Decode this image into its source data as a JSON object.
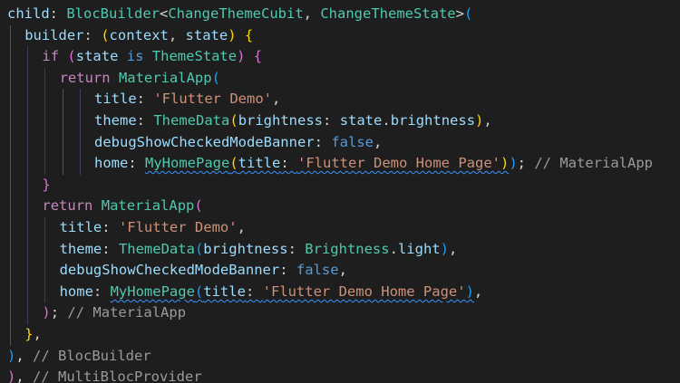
{
  "editor": {
    "theme": {
      "background": "#1e1e1e",
      "default": "#d4d4d4",
      "property": "#9cdcfe",
      "type": "#4ec9b0",
      "keyword_control": "#c586c0",
      "keyword": "#569cd6",
      "string": "#ce9178",
      "comment": "#6a9955",
      "bracket_1": "#ffd700",
      "bracket_2": "#da70d6",
      "bracket_3": "#179fff",
      "warning_squiggle": "#3794ff"
    },
    "lines": [
      {
        "indent": 0,
        "tokens": [
          {
            "t": "child",
            "c": "prop"
          },
          {
            "t": ": ",
            "c": "punc"
          },
          {
            "t": "BlocBuilder",
            "c": "type"
          },
          {
            "t": "<",
            "c": "punc"
          },
          {
            "t": "ChangeThemeCubit",
            "c": "type"
          },
          {
            "t": ", ",
            "c": "punc"
          },
          {
            "t": "ChangeThemeState",
            "c": "type"
          },
          {
            "t": ">",
            "c": "punc"
          },
          {
            "t": "(",
            "c": "b3"
          }
        ]
      },
      {
        "indent": 1,
        "tokens": [
          {
            "t": "builder",
            "c": "prop"
          },
          {
            "t": ": ",
            "c": "punc"
          },
          {
            "t": "(",
            "c": "b1"
          },
          {
            "t": "context",
            "c": "prop"
          },
          {
            "t": ", ",
            "c": "punc"
          },
          {
            "t": "state",
            "c": "prop"
          },
          {
            "t": ")",
            "c": "b1"
          },
          {
            "t": " ",
            "c": "punc"
          },
          {
            "t": "{",
            "c": "b1"
          }
        ]
      },
      {
        "indent": 2,
        "tokens": [
          {
            "t": "if",
            "c": "kw"
          },
          {
            "t": " ",
            "c": "punc"
          },
          {
            "t": "(",
            "c": "b2"
          },
          {
            "t": "state",
            "c": "prop"
          },
          {
            "t": " ",
            "c": "punc"
          },
          {
            "t": "is",
            "c": "kwb"
          },
          {
            "t": " ",
            "c": "punc"
          },
          {
            "t": "ThemeState",
            "c": "type"
          },
          {
            "t": ")",
            "c": "b2"
          },
          {
            "t": " ",
            "c": "punc"
          },
          {
            "t": "{",
            "c": "b2"
          }
        ]
      },
      {
        "indent": 3,
        "tokens": [
          {
            "t": "return",
            "c": "kw"
          },
          {
            "t": " ",
            "c": "punc"
          },
          {
            "t": "MaterialApp",
            "c": "type"
          },
          {
            "t": "(",
            "c": "b3"
          }
        ]
      },
      {
        "indent": 5,
        "tokens": [
          {
            "t": "title",
            "c": "prop"
          },
          {
            "t": ": ",
            "c": "punc"
          },
          {
            "t": "'Flutter Demo'",
            "c": "str"
          },
          {
            "t": ",",
            "c": "punc"
          }
        ]
      },
      {
        "indent": 5,
        "tokens": [
          {
            "t": "theme",
            "c": "prop"
          },
          {
            "t": ": ",
            "c": "punc"
          },
          {
            "t": "ThemeData",
            "c": "type"
          },
          {
            "t": "(",
            "c": "b1"
          },
          {
            "t": "brightness",
            "c": "prop"
          },
          {
            "t": ": ",
            "c": "punc"
          },
          {
            "t": "state",
            "c": "prop"
          },
          {
            "t": ".",
            "c": "punc"
          },
          {
            "t": "brightness",
            "c": "prop"
          },
          {
            "t": ")",
            "c": "b1"
          },
          {
            "t": ",",
            "c": "punc"
          }
        ]
      },
      {
        "indent": 5,
        "tokens": [
          {
            "t": "debugShowCheckedModeBanner",
            "c": "prop"
          },
          {
            "t": ": ",
            "c": "punc"
          },
          {
            "t": "false",
            "c": "kwb"
          },
          {
            "t": ",",
            "c": "punc"
          }
        ]
      },
      {
        "indent": 5,
        "tokens": [
          {
            "t": "home",
            "c": "prop"
          },
          {
            "t": ": ",
            "c": "punc"
          },
          {
            "t": "MyHomePage",
            "c": "type",
            "sq": true
          },
          {
            "t": "(",
            "c": "b1",
            "sq": true
          },
          {
            "t": "title",
            "c": "prop",
            "sq": true
          },
          {
            "t": ": ",
            "c": "punc",
            "sq": true
          },
          {
            "t": "'Flutter Demo Home Page'",
            "c": "str",
            "sq": true
          },
          {
            "t": ")",
            "c": "b1",
            "sq": true
          },
          {
            "t": ")",
            "c": "b3"
          },
          {
            "t": ";",
            "c": "punc"
          },
          {
            "t": " // MaterialApp",
            "c": "cmtg"
          }
        ]
      },
      {
        "indent": 2,
        "tokens": [
          {
            "t": "}",
            "c": "b2"
          }
        ]
      },
      {
        "indent": 2,
        "tokens": [
          {
            "t": "return",
            "c": "kw"
          },
          {
            "t": " ",
            "c": "punc"
          },
          {
            "t": "MaterialApp",
            "c": "type"
          },
          {
            "t": "(",
            "c": "b2"
          }
        ]
      },
      {
        "indent": 3,
        "tokens": [
          {
            "t": "title",
            "c": "prop"
          },
          {
            "t": ": ",
            "c": "punc"
          },
          {
            "t": "'Flutter Demo'",
            "c": "str"
          },
          {
            "t": ",",
            "c": "punc"
          }
        ]
      },
      {
        "indent": 3,
        "tokens": [
          {
            "t": "theme",
            "c": "prop"
          },
          {
            "t": ": ",
            "c": "punc"
          },
          {
            "t": "ThemeData",
            "c": "type"
          },
          {
            "t": "(",
            "c": "b3"
          },
          {
            "t": "brightness",
            "c": "prop"
          },
          {
            "t": ": ",
            "c": "punc"
          },
          {
            "t": "Brightness",
            "c": "type"
          },
          {
            "t": ".",
            "c": "punc"
          },
          {
            "t": "light",
            "c": "prop"
          },
          {
            "t": ")",
            "c": "b3"
          },
          {
            "t": ",",
            "c": "punc"
          }
        ]
      },
      {
        "indent": 3,
        "tokens": [
          {
            "t": "debugShowCheckedModeBanner",
            "c": "prop"
          },
          {
            "t": ": ",
            "c": "punc"
          },
          {
            "t": "false",
            "c": "kwb"
          },
          {
            "t": ",",
            "c": "punc"
          }
        ]
      },
      {
        "indent": 3,
        "tokens": [
          {
            "t": "home",
            "c": "prop"
          },
          {
            "t": ": ",
            "c": "punc"
          },
          {
            "t": "MyHomePage",
            "c": "type",
            "sq": true
          },
          {
            "t": "(",
            "c": "b3",
            "sq": true
          },
          {
            "t": "title",
            "c": "prop",
            "sq": true
          },
          {
            "t": ": ",
            "c": "punc",
            "sq": true
          },
          {
            "t": "'Flutter Demo Home Page'",
            "c": "str",
            "sq": true
          },
          {
            "t": ")",
            "c": "b3",
            "sq": true
          },
          {
            "t": ",",
            "c": "punc"
          }
        ]
      },
      {
        "indent": 2,
        "tokens": [
          {
            "t": ")",
            "c": "b2"
          },
          {
            "t": ";",
            "c": "punc"
          },
          {
            "t": " // MaterialApp",
            "c": "cmtg"
          }
        ]
      },
      {
        "indent": 1,
        "tokens": [
          {
            "t": "}",
            "c": "b1"
          },
          {
            "t": ",",
            "c": "punc"
          }
        ]
      },
      {
        "indent": 0,
        "tokens": [
          {
            "t": ")",
            "c": "b3"
          },
          {
            "t": ",",
            "c": "punc"
          },
          {
            "t": " // BlocBuilder",
            "c": "cmtg"
          }
        ]
      },
      {
        "indent": 0,
        "tokens": [
          {
            "t": ")",
            "c": "b2"
          },
          {
            "t": ",",
            "c": "punc"
          },
          {
            "t": " // MultiBlocProvider",
            "c": "cmtg"
          }
        ]
      }
    ]
  }
}
